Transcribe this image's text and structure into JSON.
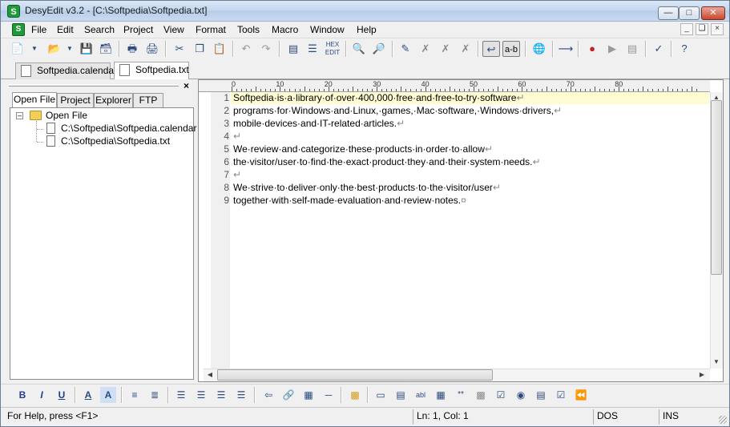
{
  "window": {
    "title": "DesyEdit v3.2 - [C:\\Softpedia\\Softpedia.txt]",
    "app_icon_letter": "S"
  },
  "menu": [
    "File",
    "Edit",
    "Search",
    "Project",
    "View",
    "Format",
    "Tools",
    "Macro",
    "Window",
    "Help"
  ],
  "toolbar": {
    "icons": [
      "new-icon",
      "new-dropdown-icon",
      "open-icon",
      "open-dropdown-icon",
      "save-icon",
      "save-all-icon",
      "print-preview-icon",
      "print-icon",
      "cut-icon",
      "copy-icon",
      "paste-icon",
      "undo-icon",
      "redo-icon",
      "block-icon",
      "list-icon",
      "hex-icon",
      "find-icon",
      "find-replace-icon",
      "bookmark-icon",
      "bookmark-next-icon",
      "bookmark-prev-icon",
      "bookmark-clear-icon",
      "show-whitespace-icon",
      "word-wrap-icon",
      "browser-icon",
      "pin-icon",
      "record-macro-icon",
      "play-macro-icon",
      "macro-list-icon",
      "spell-check-icon",
      "help-icon"
    ],
    "word_wrap_label": "a-b"
  },
  "doc_tabs": [
    {
      "label": "Softpedia.calendar",
      "active": false
    },
    {
      "label": "Softpedia.txt",
      "active": true
    }
  ],
  "panel": {
    "tabs": [
      "Open File",
      "Project",
      "Explorer",
      "FTP"
    ],
    "active_tab": "Open File",
    "tree_root": "Open File",
    "tree_items": [
      "C:\\Softpedia\\Softpedia.calendar",
      "C:\\Softpedia\\Softpedia.txt"
    ],
    "close_glyph": "×"
  },
  "ruler": {
    "marks": [
      "0",
      "10",
      "20",
      "30",
      "40",
      "50",
      "60",
      "70",
      "80"
    ]
  },
  "editor": {
    "lines": [
      {
        "num": "1",
        "text": "Softpedia·is·a·library·of·over·400,000·free·and·free-to-try·software"
      },
      {
        "num": "2",
        "text": "programs·for·Windows·and·Linux,·games,·Mac·software,·Windows·drivers,"
      },
      {
        "num": "3",
        "text": "mobile·devices·and·IT-related·articles."
      },
      {
        "num": "4",
        "text": ""
      },
      {
        "num": "5",
        "text": "We·review·and·categorize·these·products·in·order·to·allow"
      },
      {
        "num": "6",
        "text": "the·visitor/user·to·find·the·exact·product·they·and·their·system·needs."
      },
      {
        "num": "7",
        "text": ""
      },
      {
        "num": "8",
        "text": "We·strive·to·deliver·only·the·best·products·to·the·visitor/user"
      },
      {
        "num": "9",
        "text": "together·with·self-made·evaluation·and·review·notes."
      }
    ],
    "eol_glyph": "↵",
    "eof_glyph": "¤"
  },
  "bottom_toolbar": {
    "icons": [
      "bold-icon",
      "italic-icon",
      "underline-icon",
      "font-color-icon",
      "highlight-icon",
      "bullet-list-icon",
      "numbered-list-icon",
      "align-left-icon",
      "align-center-icon",
      "align-right-icon",
      "justify-icon",
      "anchor-icon",
      "link-icon",
      "image-icon",
      "horizontal-rule-icon",
      "form-icon",
      "button-icon",
      "text-field-icon",
      "text-area-icon",
      "select-icon",
      "password-icon",
      "hidden-field-icon",
      "checkbox-icon",
      "radio-icon",
      "list-box-icon",
      "submit-icon",
      "reset-icon"
    ],
    "labels": {
      "bold": "B",
      "italic": "I",
      "underline": "U"
    }
  },
  "status": {
    "help": "For Help, press <F1>",
    "position": "Ln: 1, Col: 1",
    "format": "DOS",
    "mode": "INS"
  }
}
